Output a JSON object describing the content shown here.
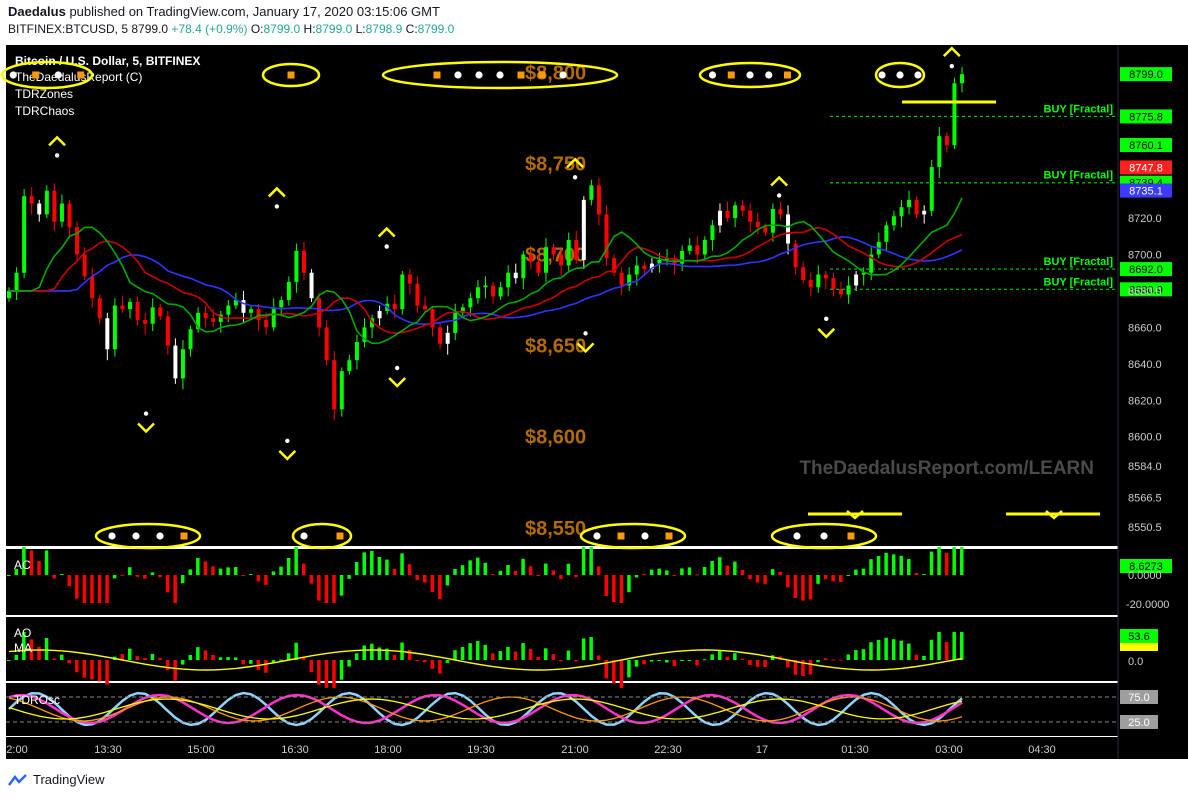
{
  "header": {
    "author": "Daedalus",
    "published": "published on TradingView.com, January 17, 2020 03:15:06 GMT",
    "symbol": "BITFINEX:BTCUSD, 5",
    "last": "8799.0",
    "change": "+78.4 (+0.9%)",
    "ohlc": {
      "o_label": "O:",
      "o": "8799.0",
      "h_label": "H:",
      "h": "8799.0",
      "l_label": "L:",
      "l": "8798.9",
      "c_label": "C:",
      "c": "8799.0"
    }
  },
  "legend": {
    "title": "Bitcoin / U.S. Dollar, 5, BITFINEX",
    "indicators": [
      "TheDaedalusReport (C)",
      "TDRZones",
      "TDRChaos"
    ]
  },
  "watermark": "TheDaedalusReport.com/LEARN",
  "footer": {
    "brand": "TradingView"
  },
  "colors": {
    "background": "#000000",
    "up": "#00ff00",
    "down": "#ff0000",
    "neutral": "#ffffff",
    "jaw": "#3333ff",
    "teeth": "#cc0000",
    "lips": "#00aa00",
    "marker": "#ffff00",
    "level_text": "#b36b00",
    "signal_orange": "#ff9900",
    "fractal_line": "#00cc00"
  },
  "chart_data": {
    "type": "candlestick",
    "symbol": "BTCUSD",
    "timeframe": "5",
    "exchange": "BITFINEX",
    "x_ticks": [
      "2:00",
      "13:30",
      "15:00",
      "16:30",
      "18:00",
      "19:30",
      "21:00",
      "22:30",
      "17",
      "01:30",
      "03:00",
      "04:30"
    ],
    "y_ticks": [
      "8720.0",
      "8700.0",
      "8680.0",
      "8660.0",
      "8640.0",
      "8620.0",
      "8600.0",
      "8584.0",
      "8566.5",
      "8550.5"
    ],
    "ylim": [
      8540,
      8815
    ],
    "close": [
      8680,
      8690,
      8732,
      8728,
      8722,
      8735,
      8718,
      8728,
      8715,
      8700,
      8688,
      8676,
      8665,
      8648,
      8672,
      8670,
      8674,
      8664,
      8662,
      8671,
      8666,
      8650,
      8632,
      8648,
      8659,
      8668,
      8665,
      8663,
      8667,
      8672,
      8675,
      8668,
      8670,
      8664,
      8660,
      8671,
      8675,
      8685,
      8702,
      8690,
      8676,
      8660,
      8642,
      8615,
      8636,
      8642,
      8652,
      8660,
      8665,
      8669,
      8673,
      8670,
      8689,
      8684,
      8672,
      8670,
      8660,
      8651,
      8657,
      8668,
      8671,
      8676,
      8682,
      8683,
      8677,
      8682,
      8690,
      8687,
      8700,
      8696,
      8690,
      8704,
      8700,
      8694,
      8708,
      8697,
      8730,
      8738,
      8722,
      8698,
      8690,
      8683,
      8689,
      8694,
      8692,
      8695,
      8697,
      8698,
      8695,
      8702,
      8705,
      8700,
      8708,
      8716,
      8724,
      8720,
      8727,
      8724,
      8718,
      8715,
      8712,
      8725,
      8722,
      8706,
      8693,
      8686,
      8682,
      8689,
      8687,
      8681,
      8678,
      8683,
      8689,
      8690,
      8700,
      8707,
      8716,
      8721,
      8726,
      8730,
      8722,
      8724,
      8748,
      8765,
      8760,
      8794,
      8799
    ],
    "markers": {
      "fractal_up": [
        {
          "time": "12:45",
          "price": 8750
        },
        {
          "time": "16:15",
          "price": 8722
        },
        {
          "time": "18:00",
          "price": 8700
        },
        {
          "time": "21:00",
          "price": 8738
        },
        {
          "time": "00:15",
          "price": 8728
        },
        {
          "time": "03:00",
          "price": 8799
        }
      ],
      "fractal_down": [
        {
          "time": "14:10",
          "price": 8616
        },
        {
          "time": "16:25",
          "price": 8601
        },
        {
          "time": "18:10",
          "price": 8641
        },
        {
          "time": "21:10",
          "price": 8660
        },
        {
          "time": "01:00",
          "price": 8668
        }
      ]
    },
    "price_levels": [
      "$8,800",
      "$8,750",
      "$8,700",
      "$8,650",
      "$8,600",
      "$8,550"
    ],
    "buy_fractals": [
      {
        "label": "BUY [Fractal]",
        "price": "8775.8"
      },
      {
        "label": "BUY [Fractal]",
        "price": "8739.4"
      },
      {
        "label": "BUY [Fractal]",
        "price": "8692.0"
      },
      {
        "label": "BUY [Fractal]",
        "price": "8680.9"
      }
    ],
    "axis_badges": [
      "8799.0",
      "8760.1",
      "8747.8",
      "8739.4",
      "8735.1"
    ],
    "panes": [
      {
        "name": "AC",
        "value": "8.6273",
        "ticks": [
          "0.0000",
          "-20.0000"
        ]
      },
      {
        "name": "AO",
        "name2": "MA",
        "value": "53.6",
        "ticks": [
          "0.0"
        ]
      },
      {
        "name": "TDROsc",
        "value": "75.0",
        "ticks": [
          "25.0"
        ]
      }
    ]
  }
}
